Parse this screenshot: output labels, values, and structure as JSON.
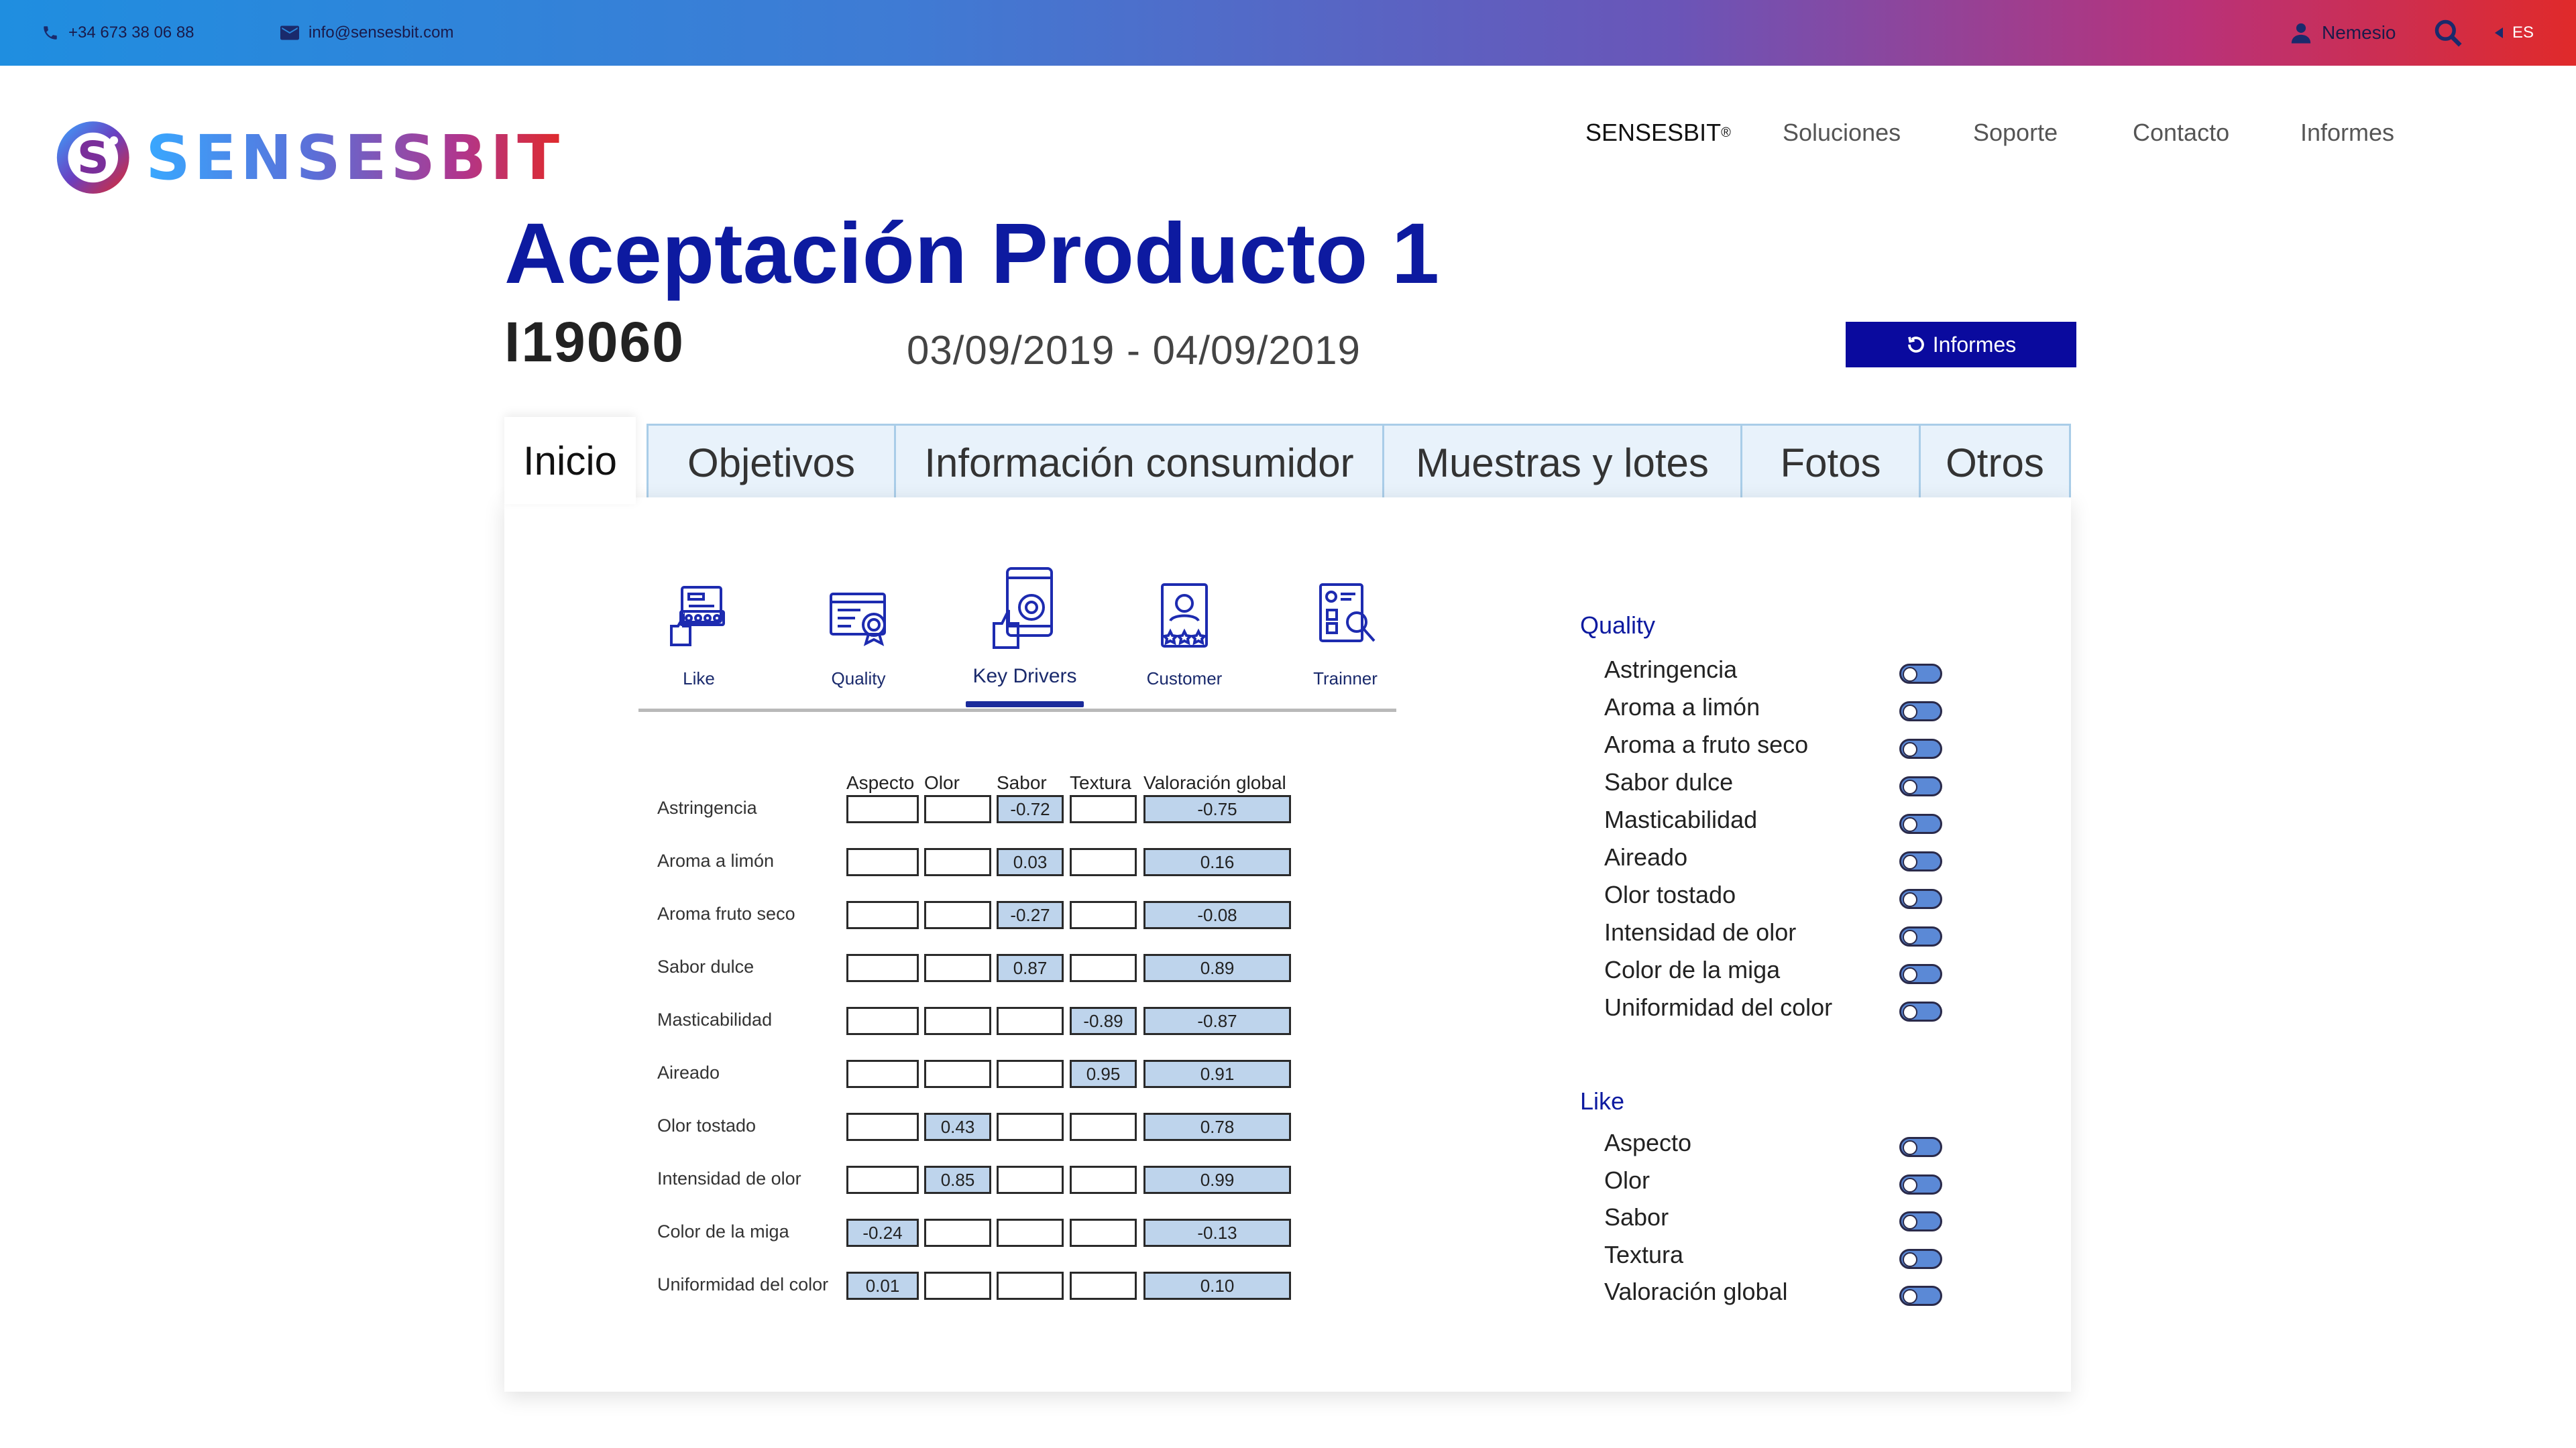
{
  "topbar": {
    "phone": "+34 673 38 06 88",
    "email": "info@sensesbit.com",
    "user": "Nemesio",
    "lang": "ES"
  },
  "logo": {
    "text": "SENSESBIT"
  },
  "nav": {
    "brand": "SENSESBIT",
    "brand_mark": "®",
    "items": [
      "Soluciones",
      "Soporte",
      "Contacto",
      "Informes"
    ]
  },
  "header": {
    "title": "Aceptación Producto 1",
    "code": "I19060",
    "dates": "03/09/2019 - 04/09/2019",
    "reports_button": "Informes"
  },
  "tabs": [
    "Inicio",
    "Objetivos",
    "Información consumidor",
    "Muestras y lotes",
    "Fotos",
    "Otros"
  ],
  "icon_nav": [
    "Like",
    "Quality",
    "Key Drivers",
    "Customer",
    "Trainner"
  ],
  "table": {
    "columns": [
      "Aspecto",
      "Olor",
      "Sabor",
      "Textura",
      "Valoración global"
    ],
    "rows": [
      {
        "label": "Astringencia",
        "values": [
          "",
          "",
          "-0.72",
          "",
          "-0.75"
        ]
      },
      {
        "label": "Aroma a limón",
        "values": [
          "",
          "",
          "0.03",
          "",
          "0.16"
        ]
      },
      {
        "label": "Aroma fruto seco",
        "values": [
          "",
          "",
          "-0.27",
          "",
          "-0.08"
        ]
      },
      {
        "label": "Sabor dulce",
        "values": [
          "",
          "",
          "0.87",
          "",
          "0.89"
        ]
      },
      {
        "label": "Masticabilidad",
        "values": [
          "",
          "",
          "",
          "-0.89",
          "-0.87"
        ]
      },
      {
        "label": "Aireado",
        "values": [
          "",
          "",
          "",
          "0.95",
          "0.91"
        ]
      },
      {
        "label": "Olor tostado",
        "values": [
          "",
          "0.43",
          "",
          "",
          "0.78"
        ]
      },
      {
        "label": "Intensidad de olor",
        "values": [
          "",
          "0.85",
          "",
          "",
          "0.99"
        ]
      },
      {
        "label": "Color de la miga",
        "values": [
          "-0.24",
          "",
          "",
          "",
          "-0.13"
        ]
      },
      {
        "label": "Uniformidad del color",
        "values": [
          "0.01",
          "",
          "",
          "",
          "0.10"
        ]
      }
    ]
  },
  "quality": {
    "title": "Quality",
    "items": [
      "Astringencia",
      "Aroma a limón",
      "Aroma a fruto seco",
      "Sabor dulce",
      "Masticabilidad",
      "Aireado",
      "Olor tostado",
      "Intensidad de olor",
      "Color de la miga",
      "Uniformidad del color"
    ]
  },
  "like": {
    "title": "Like",
    "items": [
      "Aspecto",
      "Olor",
      "Sabor",
      "Textura",
      "Valoración global"
    ]
  },
  "colors": {
    "title_blue": "#0d1aa0",
    "button_blue": "#0a0a9e",
    "cell_fill": "#bed4ec",
    "tab_bg": "#e8f2fb"
  }
}
